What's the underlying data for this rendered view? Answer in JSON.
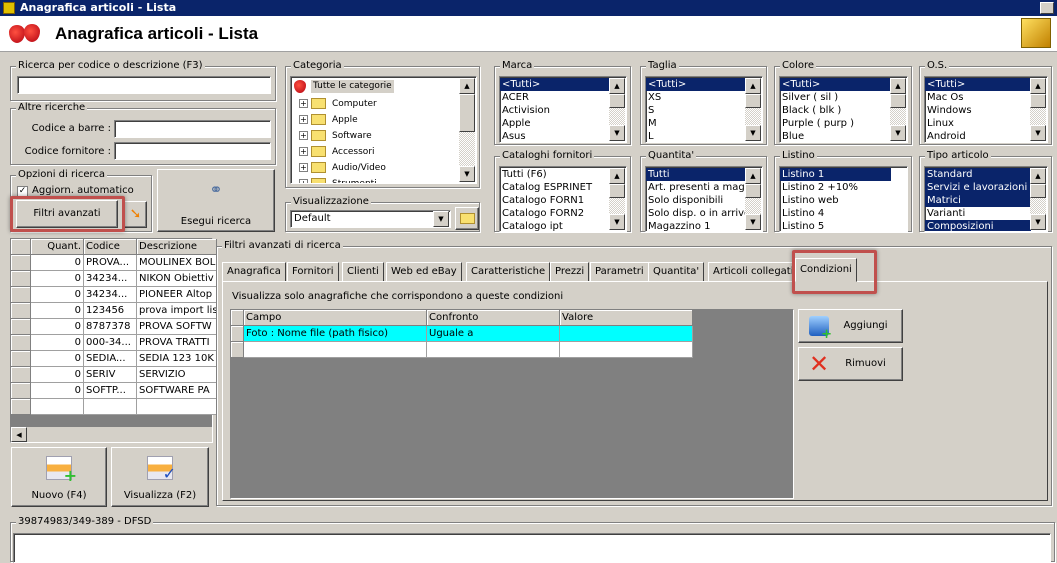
{
  "window": {
    "title": "Anagrafica articoli  - Lista"
  },
  "header": {
    "title": "Anagrafica articoli  - Lista"
  },
  "search": {
    "label": "Ricerca per codice o descrizione (F3)",
    "value": ""
  },
  "other": {
    "label": "Altre ricerche",
    "barcode_label": "Codice a barre :",
    "supplier_label": "Codice fornitore :"
  },
  "options": {
    "label": "Opzioni di ricerca",
    "auto_update": "Aggiorn. automatico",
    "auto_update_checked": true,
    "advanced": "Filtri avanzati"
  },
  "run_search": "Esegui ricerca",
  "category": {
    "label": "Categoria",
    "root": "Tutte le categorie",
    "items": [
      "Computer",
      "Apple",
      "Software",
      "Accessori",
      "Audio/Video",
      "Strumenti"
    ]
  },
  "view": {
    "label": "Visualizzazione",
    "value": "Default"
  },
  "filters": [
    {
      "label": "Marca",
      "items": [
        "<Tutti>",
        "ACER",
        "Activision",
        "Apple",
        "Asus"
      ],
      "selected": [
        0
      ]
    },
    {
      "label": "Taglia",
      "items": [
        "<Tutti>",
        "XS",
        "S",
        "M",
        "L"
      ],
      "selected": [
        0
      ]
    },
    {
      "label": "Colore",
      "items": [
        "<Tutti>",
        "Silver ( sil )",
        "Black ( blk )",
        "Purple ( purp )",
        "Blue"
      ],
      "selected": [
        0
      ]
    },
    {
      "label": "O.S.",
      "items": [
        "<Tutti>",
        "Mac Os",
        "Windows",
        "Linux",
        "Android"
      ],
      "selected": [
        0
      ]
    },
    {
      "label": "Cataloghi fornitori",
      "items": [
        "Tutti (F6)",
        "Catalog ESPRINET",
        "Catalogo FORN1",
        "Catalogo FORN2",
        "Catalogo ipt"
      ],
      "selected": []
    },
    {
      "label": "Quantita'",
      "items": [
        "Tutti",
        "Art. presenti a magazzino",
        "Solo disponibili",
        "Solo disp. o in arrivo",
        "Magazzino 1"
      ],
      "selected": [
        0
      ]
    },
    {
      "label": "Listino",
      "items": [
        "Listino 1",
        "Listino 2 +10%",
        "Listino web",
        "Listino 4",
        "Listino 5"
      ],
      "selected": [
        0
      ],
      "noscroll": true
    },
    {
      "label": "Tipo articolo",
      "items": [
        "Standard",
        "Servizi e lavorazioni",
        "Matrici",
        "Varianti",
        "Composizioni"
      ],
      "selected": [
        0,
        1,
        2,
        4
      ]
    }
  ],
  "articles": {
    "columns": [
      "Quant.",
      "Codice",
      "Descrizione"
    ],
    "rows": [
      [
        "0",
        "PROVA...",
        "MOULINEX BOL"
      ],
      [
        "0",
        "34234...",
        "NIKON Obiettiv"
      ],
      [
        "0",
        "34234...",
        "PIONEER Altop"
      ],
      [
        "0",
        "123456",
        "prova import lis"
      ],
      [
        "0",
        "8787378",
        "PROVA SOFTW"
      ],
      [
        "0",
        "000-34...",
        "PROVA TRATTI"
      ],
      [
        "0",
        "SEDIA...",
        "SEDIA 123 10K"
      ],
      [
        "0",
        "SERIV",
        "SERVIZIO"
      ],
      [
        "0",
        "SOFTP...",
        "SOFTWARE PA"
      ]
    ]
  },
  "actions": {
    "new": "Nuovo (F4)",
    "view": "Visualizza (F2)"
  },
  "advanced": {
    "label": "Filtri avanzati di ricerca",
    "tabs": [
      "Anagrafica",
      "Fornitori",
      "Clienti",
      "Web ed eBay",
      "Caratteristiche",
      "Prezzi",
      "Parametri",
      "Quantita'",
      "Articoli collegati",
      "Condizioni"
    ],
    "active_tab": "Condizioni",
    "description": "Visualizza solo anagrafiche che corrispondono a queste condizioni",
    "columns": [
      "Campo",
      "Confronto",
      "Valore"
    ],
    "rows": [
      [
        "Foto : Nome file (path fisico)",
        "Uguale a",
        ""
      ],
      [
        "",
        "",
        ""
      ]
    ],
    "add": "Aggiungi",
    "remove": "Rimuovi"
  },
  "footer": {
    "label": "39874983/349-389 - DFSD"
  },
  "colors": {
    "selection": "#0a246a",
    "highlight_row": "#00ffff",
    "callout": "#c0504d"
  }
}
